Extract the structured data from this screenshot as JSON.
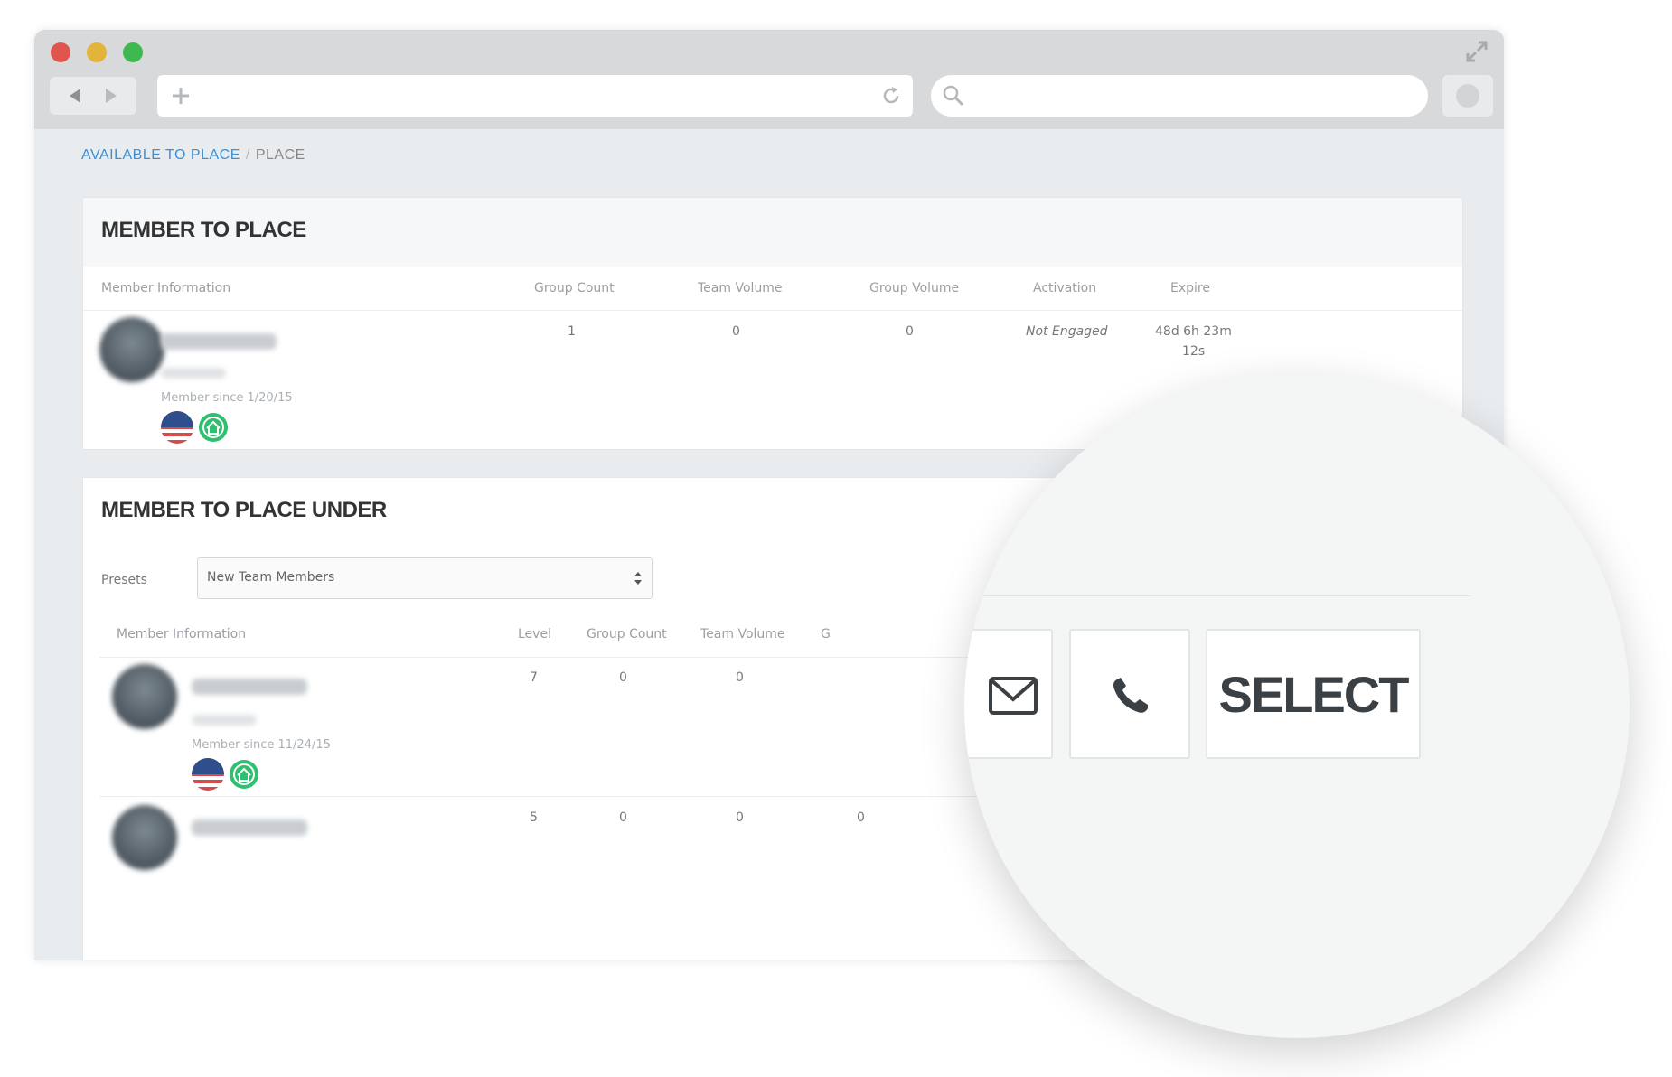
{
  "breadcrumb": {
    "link": "AVAILABLE TO PLACE",
    "separator": "/",
    "current": "PLACE"
  },
  "panel1": {
    "title": "MEMBER TO PLACE",
    "columns": [
      "Member Information",
      "Group Count",
      "Team Volume",
      "Group Volume",
      "Activation",
      "Expire"
    ],
    "row": {
      "member_since": "Member since 1/20/15",
      "group_count": "1",
      "team_volume": "0",
      "group_volume": "0",
      "activation": "Not Engaged",
      "expire": "48d 6h 23m",
      "expire_second_line": "12s"
    }
  },
  "panel2": {
    "title": "MEMBER TO PLACE UNDER",
    "presets_label": "Presets",
    "presets_value": "New Team Members",
    "columns": [
      "Member Information",
      "Level",
      "Group Count",
      "Team Volume",
      "G"
    ],
    "rows": [
      {
        "member_since": "Member since 11/24/15",
        "level": "7",
        "group_count": "0",
        "team_volume": "0"
      },
      {
        "level": "5",
        "group_count": "0",
        "team_volume": "0",
        "group_volume": "0"
      }
    ]
  },
  "magnifier": {
    "select_label": "SELECT"
  },
  "icons": {
    "back": "back-arrow-icon",
    "forward": "forward-arrow-icon",
    "new_tab": "plus-icon",
    "reload": "reload-icon",
    "search": "search-icon",
    "expand": "expand-icon",
    "flag": "us-flag-icon",
    "badge": "home-badge-icon",
    "email": "envelope-icon",
    "phone": "phone-icon"
  },
  "colors": {
    "link": "#3a8fd9",
    "badge_green": "#2fbf71",
    "traffic_red": "#e0554d",
    "traffic_yellow": "#e2b43b",
    "traffic_green": "#3fb94f"
  }
}
